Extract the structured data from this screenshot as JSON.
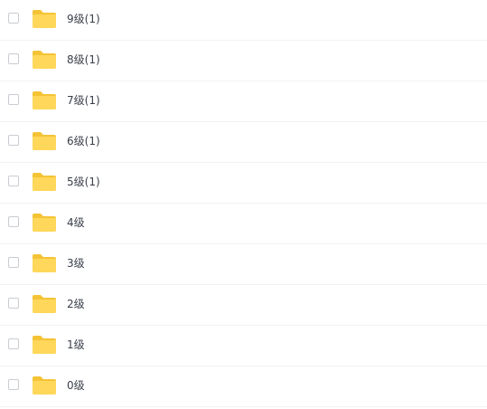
{
  "files": [
    {
      "name": "9级(1)",
      "type": "folder",
      "icon": "folder-icon"
    },
    {
      "name": "8级(1)",
      "type": "folder",
      "icon": "folder-icon"
    },
    {
      "name": "7级(1)",
      "type": "folder",
      "icon": "folder-icon"
    },
    {
      "name": "6级(1)",
      "type": "folder",
      "icon": "folder-icon"
    },
    {
      "name": "5级(1)",
      "type": "folder",
      "icon": "folder-icon"
    },
    {
      "name": "4级",
      "type": "folder",
      "icon": "folder-icon"
    },
    {
      "name": "3级",
      "type": "folder",
      "icon": "folder-icon"
    },
    {
      "name": "2级",
      "type": "folder",
      "icon": "folder-icon"
    },
    {
      "name": "1级",
      "type": "folder",
      "icon": "folder-icon"
    },
    {
      "name": "0级",
      "type": "folder",
      "icon": "folder-icon"
    }
  ],
  "colors": {
    "folder_back": "#f4c336",
    "folder_front": "#ffd75a",
    "text": "#3a3f4a",
    "divider": "#f1f2f4"
  }
}
